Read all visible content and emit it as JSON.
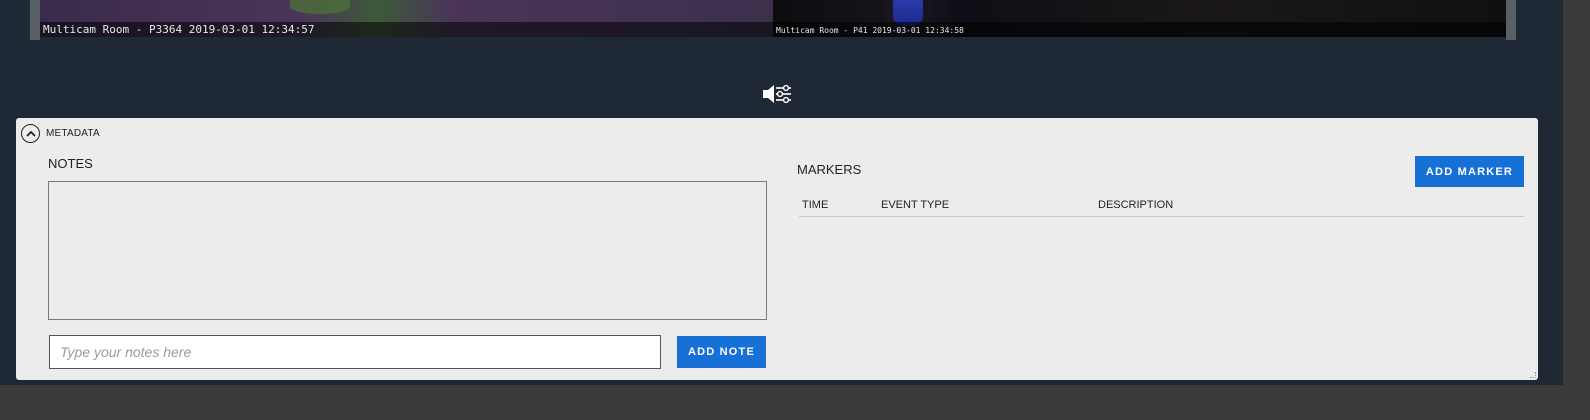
{
  "video": {
    "left_caption": "Multicam Room - P3364 2019-03-01 12:34:57",
    "right_caption": "Multicam Room - P41 2019-03-01 12:34:58"
  },
  "icons": {
    "audio_settings": "speaker-sliders-icon",
    "collapse": "chevron-up-circle-icon"
  },
  "metadata": {
    "header": "METADATA",
    "notes": {
      "title": "NOTES",
      "text_value": "",
      "input_placeholder": "Type your notes here",
      "add_button": "ADD NOTE"
    },
    "markers": {
      "title": "MARKERS",
      "add_button": "ADD MARKER",
      "columns": [
        "TIME",
        "EVENT TYPE",
        "DESCRIPTION"
      ],
      "rows": []
    }
  },
  "colors": {
    "app_background": "#1f2835",
    "panel_background": "#ececea",
    "accent_button": "#1670d6",
    "outer_background": "#3a3a3a"
  }
}
